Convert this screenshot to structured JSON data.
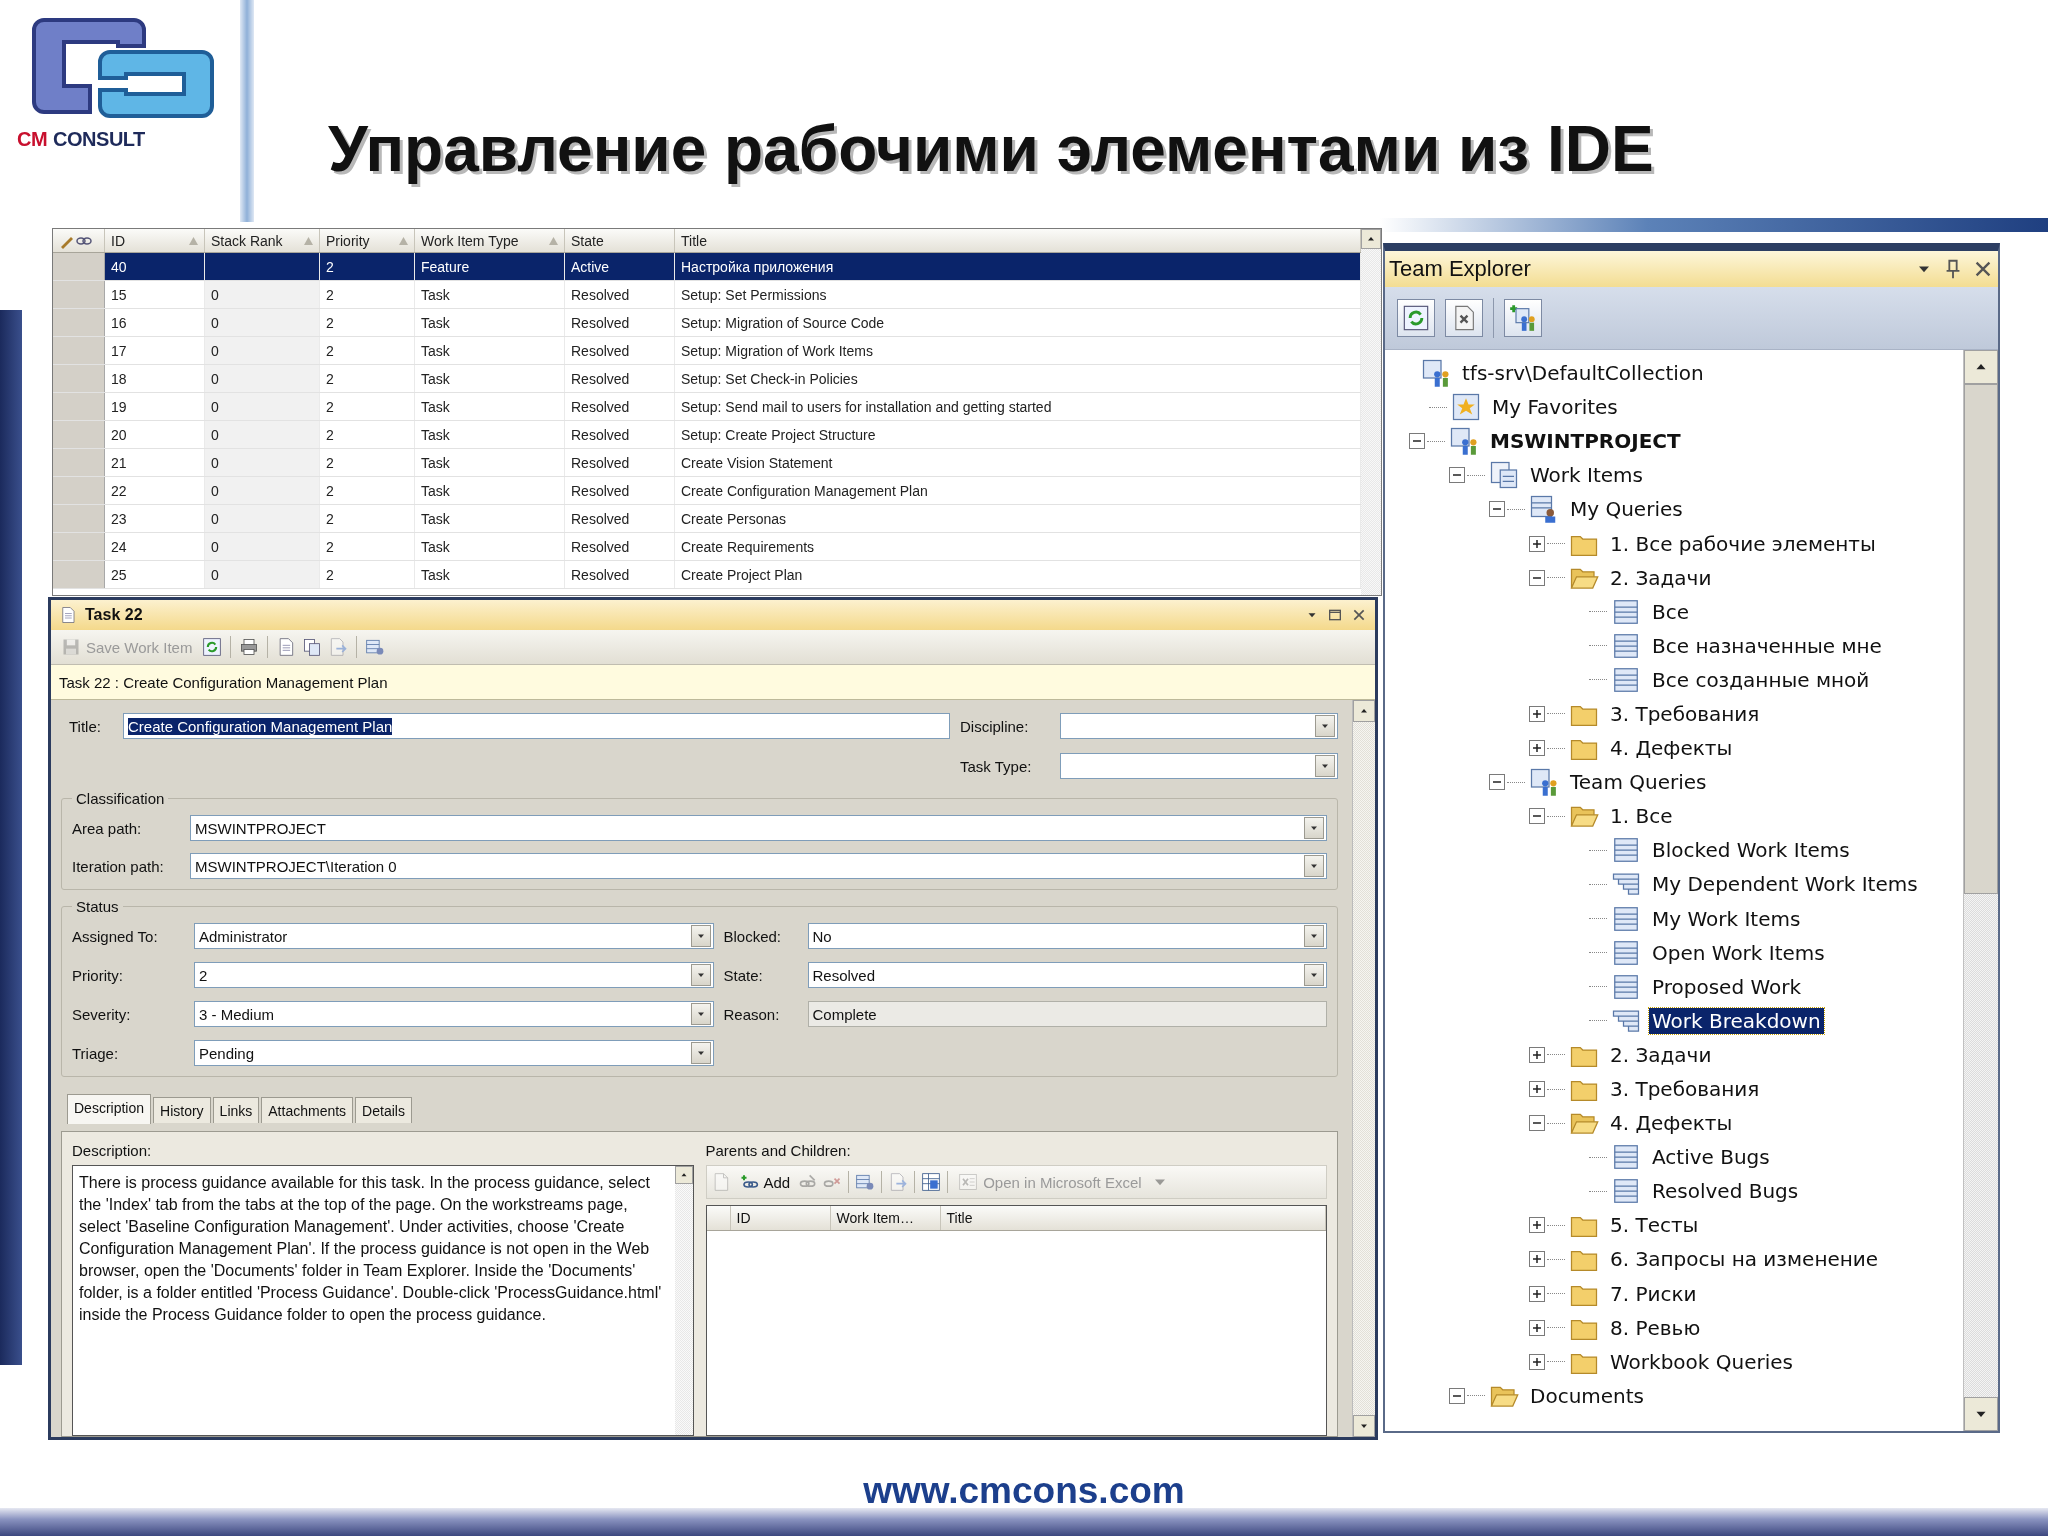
{
  "slide": {
    "logo_words": [
      "CM",
      "CONSULT"
    ],
    "title": "Управление рабочими элементами из IDE",
    "footer": "www.cmcons.com"
  },
  "results": {
    "columns": [
      {
        "label": "ID",
        "sort_mark": true
      },
      {
        "label": "Stack Rank",
        "sort_mark": true
      },
      {
        "label": "Priority",
        "sort_mark": true
      },
      {
        "label": "Work Item Type",
        "sort_mark": true
      },
      {
        "label": "State",
        "sort_mark": false
      },
      {
        "label": "Title",
        "sort_mark": false
      }
    ],
    "rows": [
      {
        "selected": true,
        "id": "40",
        "priority": "2",
        "type": "Feature",
        "state": "Active",
        "title": "Настройка приложения"
      },
      {
        "selected": false,
        "id": "15",
        "stack_rank": "0",
        "priority": "2",
        "type": "Task",
        "state": "Resolved",
        "title": "Setup: Set Permissions"
      },
      {
        "selected": false,
        "id": "16",
        "stack_rank": "0",
        "priority": "2",
        "type": "Task",
        "state": "Resolved",
        "title": "Setup: Migration of Source Code"
      },
      {
        "selected": false,
        "id": "17",
        "stack_rank": "0",
        "priority": "2",
        "type": "Task",
        "state": "Resolved",
        "title": "Setup: Migration of Work Items"
      },
      {
        "selected": false,
        "id": "18",
        "stack_rank": "0",
        "priority": "2",
        "type": "Task",
        "state": "Resolved",
        "title": "Setup: Set Check-in Policies"
      },
      {
        "selected": false,
        "id": "19",
        "stack_rank": "0",
        "priority": "2",
        "type": "Task",
        "state": "Resolved",
        "title": "Setup: Send mail to users for installation and getting started"
      },
      {
        "selected": false,
        "id": "20",
        "stack_rank": "0",
        "priority": "2",
        "type": "Task",
        "state": "Resolved",
        "title": "Setup: Create Project Structure"
      },
      {
        "selected": false,
        "id": "21",
        "stack_rank": "0",
        "priority": "2",
        "type": "Task",
        "state": "Resolved",
        "title": "Create Vision Statement"
      },
      {
        "selected": false,
        "id": "22",
        "stack_rank": "0",
        "priority": "2",
        "type": "Task",
        "state": "Resolved",
        "title": "Create Configuration Management Plan"
      },
      {
        "selected": false,
        "id": "23",
        "stack_rank": "0",
        "priority": "2",
        "type": "Task",
        "state": "Resolved",
        "title": "Create Personas"
      },
      {
        "selected": false,
        "id": "24",
        "stack_rank": "0",
        "priority": "2",
        "type": "Task",
        "state": "Resolved",
        "title": "Create Requirements"
      },
      {
        "selected": false,
        "id": "25",
        "stack_rank": "0",
        "priority": "2",
        "type": "Task",
        "state": "Resolved",
        "title": "Create Project Plan"
      }
    ]
  },
  "task": {
    "title": "Task 22",
    "toolbar": [
      {
        "kind": "save",
        "label": "Save Work Item",
        "disabled": true
      },
      {
        "kind": "refresh",
        "disabled": false
      },
      {
        "kind": "print",
        "disabled": false,
        "separator_before": true
      },
      {
        "kind": "new-linked",
        "disabled": false,
        "separator_before": true
      },
      {
        "kind": "copy",
        "disabled": false
      },
      {
        "kind": "export",
        "disabled": true
      },
      {
        "kind": "query",
        "disabled": false,
        "separator_before": true
      }
    ],
    "info": "Task 22 : Create Configuration Management Plan",
    "title_field": {
      "label": "Title:",
      "value": "Create Configuration Management Plan",
      "highlighted": true
    },
    "side_fields": [
      {
        "label": "Discipline:"
      },
      {
        "label": "Task Type:"
      }
    ],
    "classification": {
      "caption": "Classification",
      "fields": [
        {
          "label": "Area path:",
          "value": "MSWINTPROJECT"
        },
        {
          "label": "Iteration path:",
          "value": "MSWINTPROJECT\\Iteration 0"
        }
      ]
    },
    "status": {
      "caption": "Status",
      "fields": [
        {
          "label": "Assigned To:",
          "value": "Administrator",
          "kind": "combo"
        },
        {
          "label": "Blocked:",
          "value": "No",
          "kind": "combo"
        },
        {
          "label": "Priority:",
          "value": "2",
          "kind": "combo"
        },
        {
          "label": "State:",
          "value": "Resolved",
          "kind": "combo"
        },
        {
          "label": "Severity:",
          "value": "3 - Medium",
          "kind": "combo"
        },
        {
          "label": "Reason:",
          "value": "Complete",
          "kind": "readonly"
        },
        {
          "label": "Triage:",
          "value": "Pending",
          "kind": "combo"
        }
      ]
    },
    "tabs": [
      {
        "label": "Description",
        "selected": true
      },
      {
        "label": "History",
        "selected": false
      },
      {
        "label": "Links",
        "selected": false
      },
      {
        "label": "Attachments",
        "selected": false
      },
      {
        "label": "Details",
        "selected": false
      }
    ],
    "description": {
      "label": "Description:",
      "text": "There is process guidance available for this task. In the process guidance, select the 'Index' tab from the tabs at the top of the page. On the workstreams page, select 'Baseline Configuration Management'. Under activities, choose 'Create Configuration Management Plan'. If the process guidance is not open in the Web browser, open the 'Documents' folder in Team Explorer. Inside the 'Documents' folder, is a folder entitled 'Process Guidance'. Double-click 'ProcessGuidance.html' inside the Process Guidance folder to open the process guidance."
    },
    "links": {
      "label": "Parents and Children:",
      "toolbar": [
        {
          "kind": "new",
          "disabled": true
        },
        {
          "kind": "add",
          "label": "Add",
          "disabled": false
        },
        {
          "kind": "edit-link",
          "disabled": true
        },
        {
          "kind": "remove",
          "disabled": true
        },
        {
          "kind": "query",
          "disabled": false,
          "separator_before": true
        },
        {
          "kind": "open",
          "disabled": true,
          "separator_before": true
        },
        {
          "kind": "grid-view",
          "disabled": false,
          "separator_before": true
        },
        {
          "kind": "excel",
          "label": "Open in Microsoft Excel",
          "disabled": true,
          "separator_before": true
        },
        {
          "kind": "dropdown",
          "disabled": true
        }
      ],
      "columns": [
        "ID",
        "Work Item…",
        "Title"
      ]
    }
  },
  "team_explorer": {
    "title": "Team Explorer",
    "toolbar": [
      {
        "kind": "refresh"
      },
      {
        "kind": "stop"
      },
      {
        "kind": "add-project",
        "separator_before": true
      }
    ],
    "tree": [
      {
        "label": "tfs-srv\\DefaultCollection",
        "kind": "server",
        "selected": false,
        "children": [
          {
            "label": "My Favorites",
            "kind": "favorites",
            "selected": false
          },
          {
            "label": "MSWINTPROJECT",
            "kind": "project",
            "selected": false,
            "expanded": true,
            "children": [
              {
                "label": "Work Items",
                "kind": "workitems",
                "selected": false,
                "expanded": true,
                "children": [
                  {
                    "label": "My Queries",
                    "kind": "myqueries",
                    "selected": false,
                    "expanded": true,
                    "children": [
                      {
                        "label": "1. Все рабочие элементы",
                        "kind": "folder",
                        "selected": false,
                        "expanded": false
                      },
                      {
                        "label": "2. Задачи",
                        "kind": "folder",
                        "selected": false,
                        "expanded": true,
                        "children": [
                          {
                            "label": "Все",
                            "kind": "query",
                            "selected": false
                          },
                          {
                            "label": "Все назначенные мне",
                            "kind": "query",
                            "selected": false
                          },
                          {
                            "label": "Все созданные мной",
                            "kind": "query",
                            "selected": false
                          }
                        ]
                      },
                      {
                        "label": "3. Требования",
                        "kind": "folder",
                        "selected": false,
                        "expanded": false
                      },
                      {
                        "label": "4. Дефекты",
                        "kind": "folder",
                        "selected": false,
                        "expanded": false
                      }
                    ]
                  },
                  {
                    "label": "Team Queries",
                    "kind": "teamqueries",
                    "selected": false,
                    "expanded": true,
                    "children": [
                      {
                        "label": "1. Все",
                        "kind": "folder",
                        "selected": false,
                        "expanded": true,
                        "children": [
                          {
                            "label": "Blocked Work Items",
                            "kind": "query",
                            "selected": false
                          },
                          {
                            "label": "My Dependent Work Items",
                            "kind": "tree-query",
                            "selected": false
                          },
                          {
                            "label": "My Work Items",
                            "kind": "query",
                            "selected": false
                          },
                          {
                            "label": "Open Work Items",
                            "kind": "query",
                            "selected": false
                          },
                          {
                            "label": "Proposed Work",
                            "kind": "query",
                            "selected": false
                          },
                          {
                            "label": "Work Breakdown",
                            "kind": "tree-query",
                            "selected": true
                          }
                        ]
                      },
                      {
                        "label": "2. Задачи",
                        "kind": "folder",
                        "selected": false,
                        "expanded": false
                      },
                      {
                        "label": "3. Требования",
                        "kind": "folder",
                        "selected": false,
                        "expanded": false
                      },
                      {
                        "label": "4. Дефекты",
                        "kind": "folder",
                        "selected": false,
                        "expanded": true,
                        "children": [
                          {
                            "label": "Active Bugs",
                            "kind": "query",
                            "selected": false
                          },
                          {
                            "label": "Resolved Bugs",
                            "kind": "query",
                            "selected": false
                          }
                        ]
                      },
                      {
                        "label": "5. Тесты",
                        "kind": "folder",
                        "selected": false,
                        "expanded": false
                      },
                      {
                        "label": "6. Запросы на изменение",
                        "kind": "folder",
                        "selected": false,
                        "expanded": false
                      },
                      {
                        "label": "7. Риски",
                        "kind": "folder",
                        "selected": false,
                        "expanded": false
                      },
                      {
                        "label": "8. Ревью",
                        "kind": "folder",
                        "selected": false,
                        "expanded": false
                      },
                      {
                        "label": "Workbook Queries",
                        "kind": "folder",
                        "selected": false,
                        "expanded": false
                      }
                    ]
                  }
                ]
              },
              {
                "label": "Documents",
                "kind": "folder",
                "selected": false,
                "expanded": true
              }
            ]
          }
        ]
      }
    ]
  }
}
